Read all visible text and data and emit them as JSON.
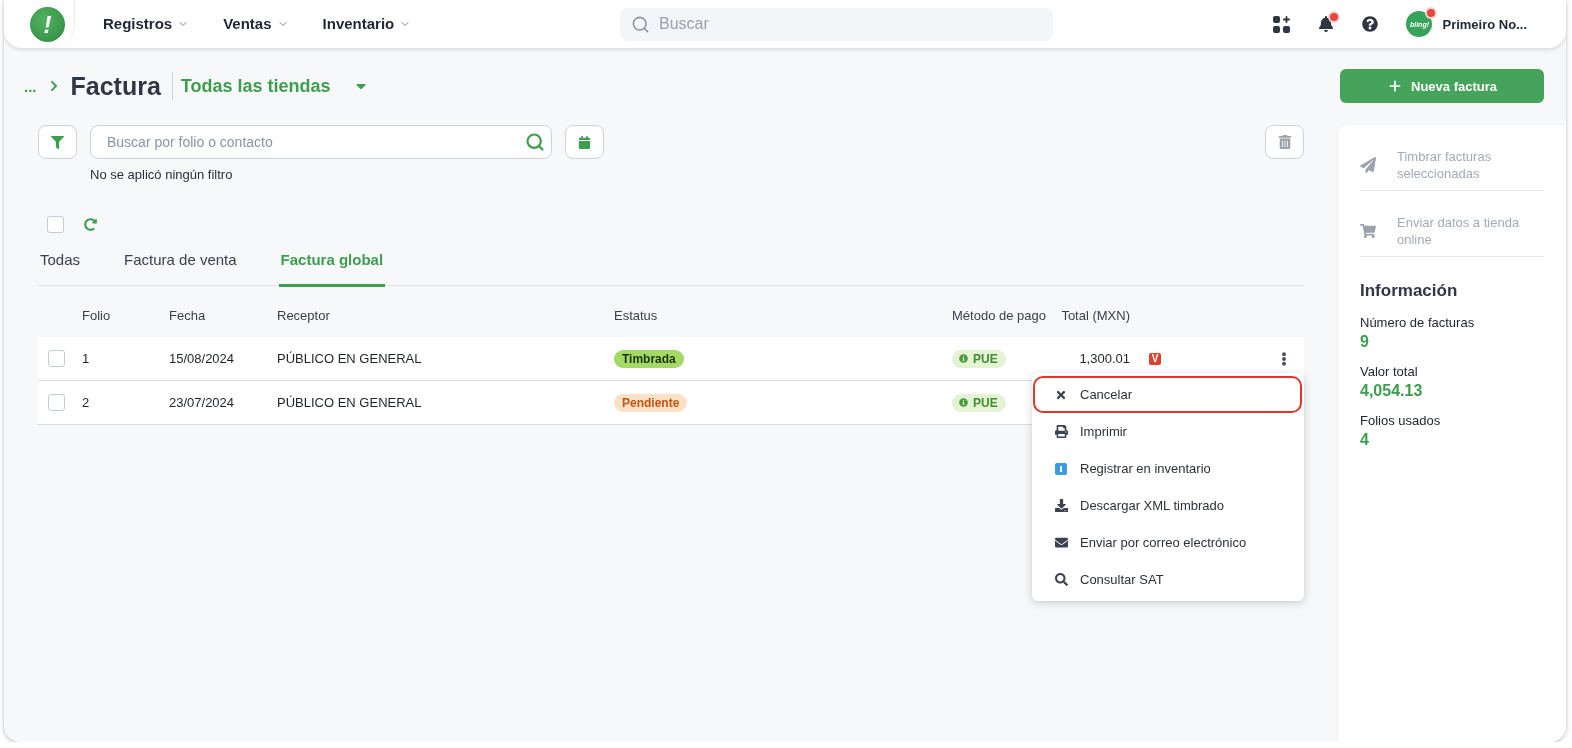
{
  "top_bar": {
    "logo": "!",
    "nav": [
      {
        "label": "Registros"
      },
      {
        "label": "Ventas"
      },
      {
        "label": "Inventario"
      }
    ],
    "search": {
      "placeholder": "Buscar"
    },
    "notifications": {
      "unread": true
    },
    "user": {
      "avatar_label": "bling!",
      "name": "Primeiro No...",
      "alert": true
    }
  },
  "header": {
    "breadcrumb": "...",
    "title": "Factura",
    "store_selector": "Todas las tiendas",
    "new_button": "Nueva factura"
  },
  "filters": {
    "search": {
      "placeholder": "Buscar por folio o contacto"
    },
    "hint": "No se aplicó ningún filtro"
  },
  "select_all": {
    "checked": false
  },
  "tabs": [
    {
      "label": "Todas",
      "selected": false
    },
    {
      "label": "Factura de venta",
      "selected": false
    },
    {
      "label": "Factura global",
      "selected": true
    }
  ],
  "table": {
    "columns": [
      "Folio",
      "Fecha",
      "Receptor",
      "Estatus",
      "Método de pago",
      "Total (MXN)"
    ],
    "rows": [
      {
        "checked": false,
        "folio": "1",
        "date": "15/08/2024",
        "receiver": "PÚBLICO EN GENERAL",
        "status": {
          "kind": "stamped",
          "label": "Timbrada"
        },
        "payment_method": "PUE",
        "total": "1,300.01",
        "tag": "V"
      },
      {
        "checked": false,
        "folio": "2",
        "date": "23/07/2024",
        "receiver": "PÚBLICO EN GENERAL",
        "status": {
          "kind": "pending",
          "label": "Pendiente"
        },
        "payment_method": "PUE"
      }
    ],
    "row_menu": {
      "open": true,
      "items": [
        {
          "kind": "cancel",
          "label": "Cancelar",
          "highlighted": true
        },
        {
          "kind": "print",
          "label": "Imprimir",
          "highlighted": false
        },
        {
          "kind": "inventory",
          "label": "Registrar en inventario",
          "highlighted": false
        },
        {
          "kind": "download",
          "label": "Descargar XML timbrado",
          "highlighted": false
        },
        {
          "kind": "mail",
          "label": "Enviar por correo electrónico",
          "highlighted": false
        },
        {
          "kind": "search",
          "label": "Consultar SAT",
          "highlighted": false
        }
      ]
    }
  },
  "side_panel": {
    "actions": [
      {
        "kind": "send",
        "label": "Timbrar facturas seleccionadas",
        "disabled": true
      },
      {
        "kind": "cart",
        "label": "Enviar datos a tienda online",
        "disabled": true
      }
    ],
    "info": {
      "title": "Información",
      "stats": [
        {
          "label": "Número de facturas",
          "value": "9"
        },
        {
          "label": "Valor total",
          "value": "4,054.13"
        },
        {
          "label": "Folios usados",
          "value": "4"
        }
      ]
    }
  }
}
